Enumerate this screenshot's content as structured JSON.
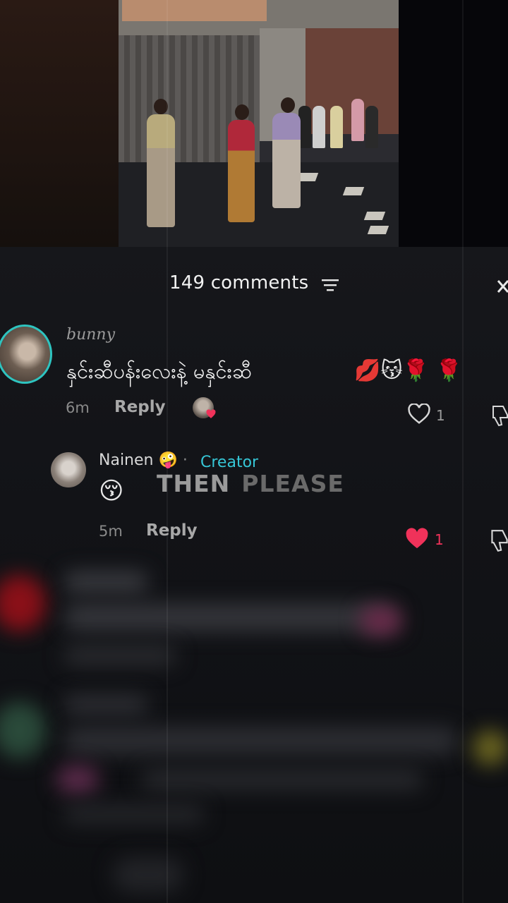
{
  "header": {
    "comment_count": "149 comments",
    "filter_icon": "filter-lines-icon",
    "close_icon": "close-icon"
  },
  "comment": {
    "username": "bunny",
    "text": "နှင်းဆီပန်းလေးနဲ့ မနှင်းဆီ",
    "emojis": "💋😽🌹 🌹",
    "timestamp": "6m",
    "reply_label": "Reply",
    "like_count": "1"
  },
  "reply": {
    "username": "Nainen",
    "name_emoji": "🤪",
    "separator": "·",
    "creator_label": "Creator",
    "text": "😚",
    "timestamp": "5m",
    "reply_label": "Reply",
    "like_count": "1",
    "liked_color": "#f0325a"
  },
  "overlay": {
    "word1": "THEN",
    "word2": "PLEASE"
  },
  "colors": {
    "accent_teal": "#36c6d6",
    "like_red": "#f0325a"
  }
}
